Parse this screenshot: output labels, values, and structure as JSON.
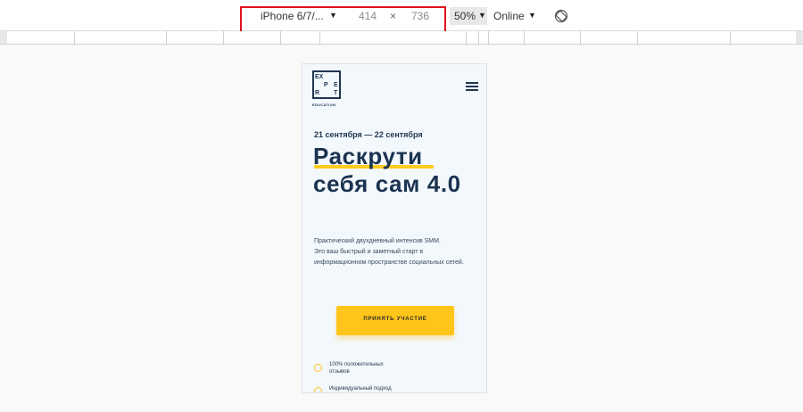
{
  "device_toolbar": {
    "device": "iPhone 6/7/...",
    "width": "414",
    "times": "×",
    "height": "736",
    "zoom": "50%",
    "network": "Online"
  },
  "site": {
    "logo_letters": [
      "EX",
      "P",
      "E",
      "R",
      "T"
    ],
    "logo_subtitle": "EDUCATION",
    "dates": "21 сентября — 22 сентября",
    "title": "Раскрути себя сам 4.0",
    "description": "Практический двухдневный интенсив SMM.\nЭто ваш быстрый и заметный старт в информационном пространстве социальных сетей.",
    "cta_label": "ПРИНЯТЬ УЧАСТИЕ",
    "features": [
      "100% положительных\nотзывов",
      "Индивидуальный подход"
    ]
  },
  "colors": {
    "highlight": "#e0131f",
    "accent": "#ffc51a",
    "navy": "#1e3550"
  }
}
